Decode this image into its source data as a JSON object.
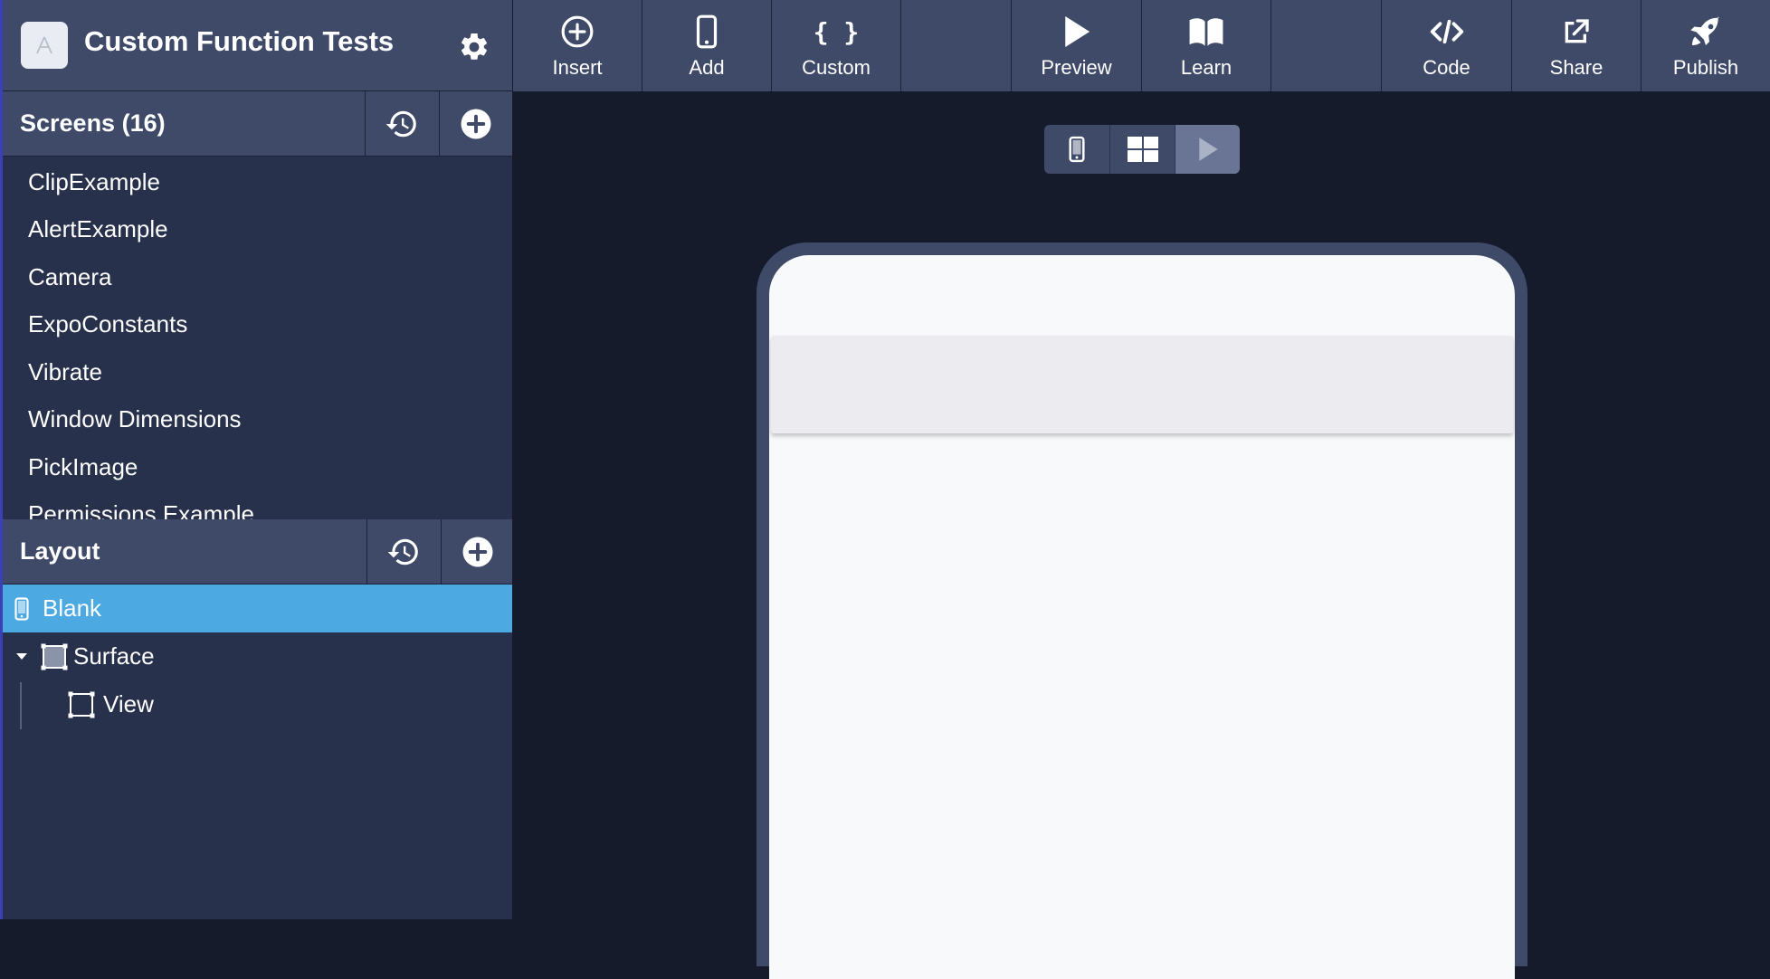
{
  "app": {
    "title": "Custom Function Tests",
    "logo_letter": "A"
  },
  "screens_panel": {
    "title": "Screens (16)",
    "items": [
      {
        "label": "ClipExample"
      },
      {
        "label": "AlertExample"
      },
      {
        "label": "Camera"
      },
      {
        "label": "ExpoConstants"
      },
      {
        "label": "Vibrate"
      },
      {
        "label": "Window Dimensions"
      },
      {
        "label": "PickImage"
      },
      {
        "label": "Permissions Example"
      }
    ]
  },
  "layout_panel": {
    "title": "Layout",
    "tree": [
      {
        "label": "Blank",
        "icon": "phone-icon",
        "selected": true
      },
      {
        "label": "Surface",
        "icon": "surface-icon",
        "expanded": true
      },
      {
        "label": "View",
        "icon": "view-icon"
      }
    ]
  },
  "toolbar": {
    "insert": "Insert",
    "add": "Add",
    "custom": "Custom",
    "custom_icon_text": "{ }",
    "preview": "Preview",
    "learn": "Learn",
    "code": "Code",
    "share": "Share",
    "publish": "Publish"
  },
  "view_toggle": {
    "options": [
      "phone-icon",
      "grid-icon",
      "play-icon"
    ],
    "active": "play-icon"
  },
  "colors": {
    "background": "#161b2b",
    "panel": "#27314b",
    "header": "#3f4a69",
    "selected": "#4ca9e1",
    "phone_screen": "#f8f9fb",
    "app_bar": "#ececf0"
  }
}
